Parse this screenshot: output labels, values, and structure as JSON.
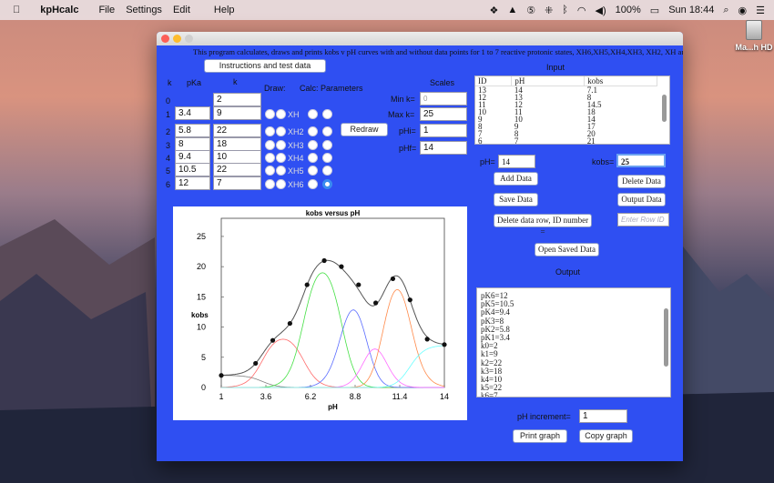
{
  "menubar": {
    "app": "kpHcalc",
    "items": [
      "File",
      "Settings",
      "Edit",
      "Help"
    ],
    "battery": "100%",
    "clock": "Sun 18:44"
  },
  "desktop": {
    "drive_label": "Ma...h HD"
  },
  "window": {
    "description": "This program calculates, draws and prints kobs v pH curves with and without data points for 1 to 7 reactive protonic states, XH6,XH5,XH4,XH3, XH2, XH and X",
    "instructions_button": "Instructions and test data",
    "headers": {
      "k_index": "k",
      "pka": "pKa",
      "k": "k",
      "draw": "Draw:",
      "calc": "Calc: Parameters",
      "scales": "Scales"
    },
    "rows": [
      {
        "index": "0",
        "pka": "",
        "k": "2",
        "species": ""
      },
      {
        "index": "1",
        "pka": "3.4",
        "k": "9",
        "species": "XH"
      },
      {
        "index": "2",
        "pka": "5.8",
        "k": "22",
        "species": "XH2"
      },
      {
        "index": "3",
        "pka": "8",
        "k": "18",
        "species": "XH3"
      },
      {
        "index": "4",
        "pka": "9.4",
        "k": "10",
        "species": "XH4"
      },
      {
        "index": "5",
        "pka": "10.5",
        "k": "22",
        "species": "XH5"
      },
      {
        "index": "6",
        "pka": "12",
        "k": "7",
        "species": "XH6"
      }
    ],
    "selected_calc_row": "6",
    "redraw_button": "Redraw",
    "scales": {
      "min_k_label": "Min k=",
      "min_k_placeholder": "0",
      "max_k_label": "Max k=",
      "max_k": "25",
      "phi_label": "pHi=",
      "phi": "1",
      "phf_label": "pHf=",
      "phf": "14"
    },
    "input": {
      "title": "Input",
      "columns": [
        "ID",
        "pH",
        "kobs"
      ],
      "rows": [
        [
          "13",
          "14",
          "7.1"
        ],
        [
          "12",
          "13",
          "8"
        ],
        [
          "11",
          "12",
          "14.5"
        ],
        [
          "10",
          "11",
          "18"
        ],
        [
          "9",
          "10",
          "14"
        ],
        [
          "8",
          "9",
          "17"
        ],
        [
          "7",
          "8",
          "20"
        ],
        [
          "6",
          "7",
          "21"
        ]
      ],
      "ph_label": "pH=",
      "ph_value": "14",
      "kobs_label": "kobs=",
      "kobs_value": "25",
      "add_data": "Add Data",
      "delete_data": "Delete Data",
      "save_data": "Save Data",
      "output_data": "Output Data",
      "delete_row": "Delete data row, ID number =",
      "row_id_placeholder": "Enter Row ID",
      "open_saved": "Open Saved Data"
    },
    "output": {
      "title": "Output",
      "lines": [
        "pK6=12",
        "pK5=10.5",
        "pK4=9.4",
        "pK3=8",
        "pK2=5.8",
        "pK1=3.4",
        "k0=2",
        "k1=9",
        "k2=22",
        "k3=18",
        "k4=10",
        "k5=22",
        "k6=7"
      ],
      "ph_increment_label": "pH increment=",
      "ph_increment": "1",
      "print_graph": "Print graph",
      "copy_graph": "Copy graph"
    }
  },
  "chart_data": {
    "type": "line",
    "title": "kobs versus pH",
    "xlabel": "pH",
    "ylabel": "kobs",
    "xlim": [
      1,
      14
    ],
    "ylim": [
      0,
      28
    ],
    "xticks": [
      "1",
      "3.6",
      "6.2",
      "8.8",
      "11.4",
      "14"
    ],
    "yticks": [
      "0",
      "5",
      "10",
      "15",
      "20",
      "25"
    ],
    "pka": [
      3.4,
      5.8,
      8,
      9.4,
      10.5,
      12
    ],
    "k": [
      2,
      9,
      22,
      18,
      10,
      22,
      7
    ],
    "component_colors": [
      "#808080",
      "#ff6a6a",
      "#44e044",
      "#5a6cff",
      "#ff6aff",
      "#ff8a4a",
      "#6affff"
    ],
    "total_color": "#555555",
    "points": {
      "x": [
        1,
        3,
        4,
        5,
        6,
        7,
        8,
        9,
        10,
        11,
        12,
        13,
        14
      ],
      "y": [
        2,
        4,
        7.8,
        10.6,
        17,
        21,
        20,
        17,
        14,
        18,
        14.5,
        8,
        7.1
      ]
    }
  }
}
